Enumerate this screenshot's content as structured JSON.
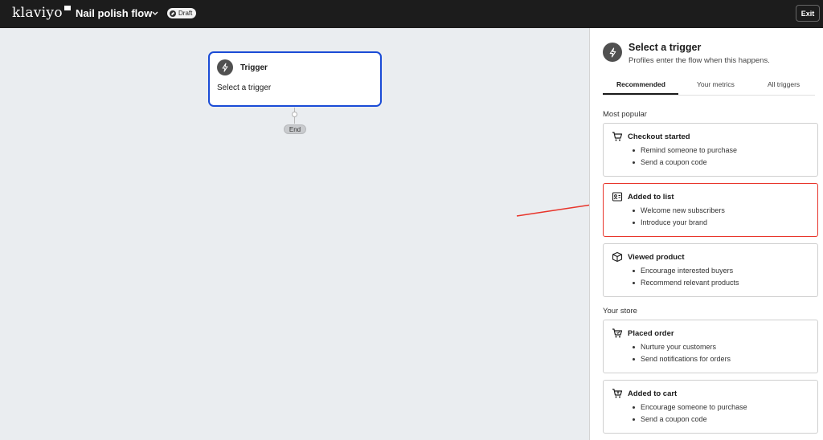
{
  "header": {
    "logo_text": "klaviyo",
    "flow_title": "Nail polish flow",
    "status_badge": "Draft",
    "exit_label": "Exit"
  },
  "canvas": {
    "trigger_node": {
      "title": "Trigger",
      "subtitle": "Select a trigger"
    },
    "end_label": "End"
  },
  "panel": {
    "title": "Select a trigger",
    "subtitle": "Profiles enter the flow when this happens.",
    "tabs": [
      {
        "label": "Recommended",
        "active": true
      },
      {
        "label": "Your metrics",
        "active": false
      },
      {
        "label": "All triggers",
        "active": false
      }
    ],
    "sections": [
      {
        "label": "Most popular",
        "cards": [
          {
            "icon": "cart-icon",
            "title": "Checkout started",
            "bullets": [
              "Remind someone to purchase",
              "Send a coupon code"
            ]
          },
          {
            "icon": "list-icon",
            "title": "Added to list",
            "bullets": [
              "Welcome new subscribers",
              "Introduce your brand"
            ],
            "highlighted": true
          },
          {
            "icon": "box-icon",
            "title": "Viewed product",
            "bullets": [
              "Encourage interested buyers",
              "Recommend relevant products"
            ]
          }
        ]
      },
      {
        "label": "Your store",
        "cards": [
          {
            "icon": "bag-icon",
            "title": "Placed order",
            "bullets": [
              "Nurture your customers",
              "Send notifications for orders"
            ]
          },
          {
            "icon": "cart-plus-icon",
            "title": "Added to cart",
            "bullets": [
              "Encourage someone to purchase",
              "Send a coupon code"
            ]
          }
        ]
      }
    ]
  },
  "colors": {
    "accent_blue": "#1a4bd6",
    "highlight_red": "#e8352b",
    "topbar": "#1c1c1c"
  }
}
